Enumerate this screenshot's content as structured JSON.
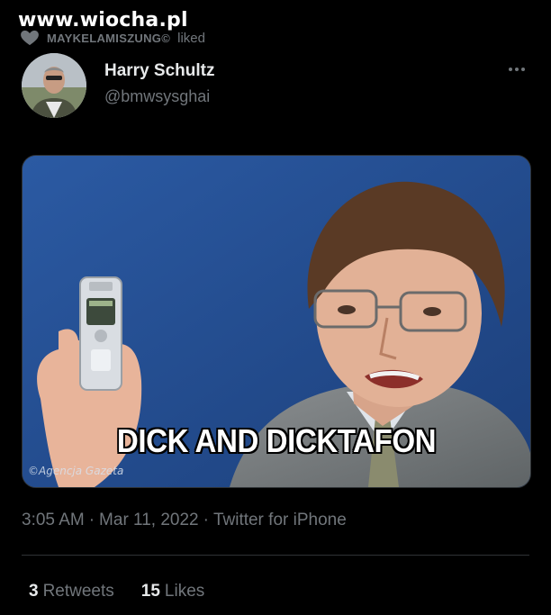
{
  "watermark": {
    "text": "www.wiocha.pl"
  },
  "context": {
    "icon": "heart-icon",
    "liker": "MAYKELAMISZUNG©",
    "action": "liked"
  },
  "tweet": {
    "author_name": "Harry Schultz",
    "author_handle": "@bmwsysghai",
    "more_icon": "more-dots-icon",
    "media": {
      "caption": "DICK AND DICKTAFON",
      "credit": "©Agencja Gazeta"
    },
    "time": "3:05 AM",
    "separator": "·",
    "date": "Mar 11, 2022",
    "source": "Twitter for iPhone"
  },
  "stats": {
    "retweets_count": "3",
    "retweets_label": "Retweets",
    "likes_count": "15",
    "likes_label": "Likes"
  },
  "colors": {
    "background": "#000000",
    "text_primary": "#e7e9ea",
    "text_secondary": "#71767b",
    "divider": "#2f3336"
  }
}
